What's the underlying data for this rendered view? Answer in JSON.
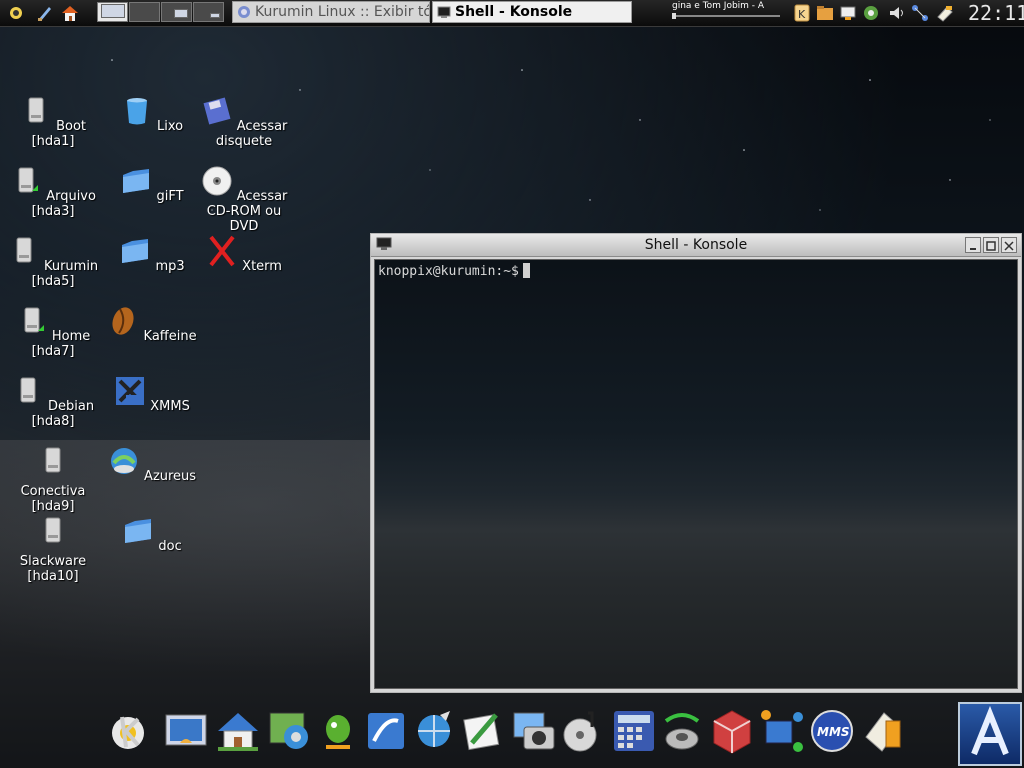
{
  "top_panel": {
    "pager": [
      "desktop-1",
      "desktop-2",
      "desktop-3",
      "desktop-4"
    ],
    "tasks": [
      {
        "label": "Kurumin Linux :: Exibir tóp",
        "active": false
      },
      {
        "label": "Shell - Konsole",
        "active": true
      }
    ],
    "now_playing": "gina e Tom Jobim - A",
    "tray_icons": [
      "kde-k-icon",
      "folder-icon",
      "network-icon",
      "update-icon",
      "volume-icon",
      "network-status-icon",
      "clipboard-icon"
    ],
    "clock": "22:11"
  },
  "desktop_icons": [
    {
      "name": "boot-hda1",
      "label": "Boot [hda1]",
      "icon": "hard-drive-icon"
    },
    {
      "name": "arquivo-hda3",
      "label": "Arquivo [hda3]",
      "icon": "hard-drive-icon"
    },
    {
      "name": "kurumin-hda5",
      "label": "Kurumin [hda5]",
      "icon": "hard-drive-icon"
    },
    {
      "name": "home-hda7",
      "label": "Home [hda7]",
      "icon": "hard-drive-icon"
    },
    {
      "name": "debian-hda8",
      "label": "Debian [hda8]",
      "icon": "hard-drive-icon"
    },
    {
      "name": "conectiva-hda9",
      "label": "Conectiva [hda9]",
      "icon": "hard-drive-icon"
    },
    {
      "name": "slackware-hda10",
      "label": "Slackware [hda10]",
      "icon": "hard-drive-icon"
    },
    {
      "name": "lixo",
      "label": "Lixo",
      "icon": "trash-icon"
    },
    {
      "name": "gift",
      "label": "giFT",
      "icon": "folder-icon"
    },
    {
      "name": "mp3",
      "label": "mp3",
      "icon": "folder-icon"
    },
    {
      "name": "kaffeine",
      "label": "Kaffeine",
      "icon": "coffee-bean-icon"
    },
    {
      "name": "xmms",
      "label": "XMMS",
      "icon": "xmms-icon"
    },
    {
      "name": "azureus",
      "label": "Azureus",
      "icon": "azureus-icon"
    },
    {
      "name": "doc",
      "label": "doc",
      "icon": "folder-icon"
    },
    {
      "name": "acessar-disquete",
      "label": "Acessar disquete",
      "icon": "floppy-icon"
    },
    {
      "name": "acessar-cdrom",
      "label": "Acessar CD-ROM ou DVD",
      "icon": "cdrom-icon"
    },
    {
      "name": "xterm",
      "label": "Xterm",
      "icon": "x-icon"
    }
  ],
  "konsole": {
    "title": "Shell - Konsole",
    "prompt": "knoppix@kurumin:~$"
  },
  "dock": [
    "kde-menu-icon",
    "desktop-icon",
    "home-icon",
    "control-center-icon",
    "gaim-icon",
    "writer-icon",
    "browser-icon",
    "editor-icon",
    "image-viewer-icon",
    "music-player-icon",
    "calculator-icon",
    "speaker-icon",
    "kmahjongg-icon",
    "network-icon",
    "mms-icon",
    "packages-icon"
  ],
  "colors": {
    "accent": "#2a5aa8",
    "panel": "#0b0b0b",
    "folder": "#4a90e0"
  }
}
